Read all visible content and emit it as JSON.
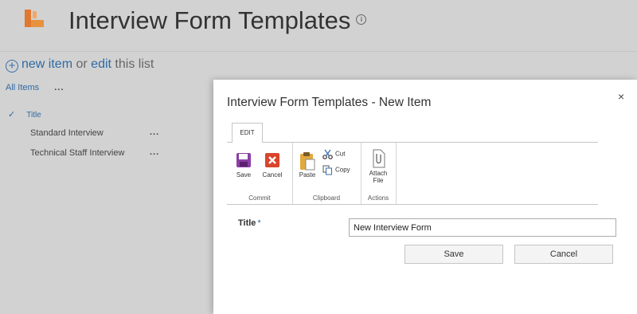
{
  "site": {
    "title": "Interview Form Templates",
    "info_glyph": "i",
    "brand_color": "#e8792c"
  },
  "commands": {
    "new_item": "new item",
    "or": "or",
    "edit": "edit",
    "this_list": "this list"
  },
  "views": {
    "current": "All Items",
    "more": "..."
  },
  "list": {
    "column_header": "Title",
    "rows": [
      {
        "title": "Standard Interview",
        "more": "..."
      },
      {
        "title": "Technical Staff Interview",
        "more": "..."
      }
    ]
  },
  "dialog": {
    "title": "Interview Form Templates - New Item",
    "close_glyph": "×",
    "ribbon": {
      "tab": "EDIT",
      "groups": {
        "commit": "Commit",
        "clipboard": "Clipboard",
        "actions": "Actions"
      },
      "buttons": {
        "save": "Save",
        "cancel": "Cancel",
        "paste": "Paste",
        "cut": "Cut",
        "copy": "Copy",
        "attach_line1": "Attach",
        "attach_line2": "File"
      }
    },
    "form": {
      "title_label": "Title",
      "required_marker": "*",
      "title_value": "New Interview Form"
    },
    "save_label": "Save",
    "cancel_label": "Cancel"
  }
}
